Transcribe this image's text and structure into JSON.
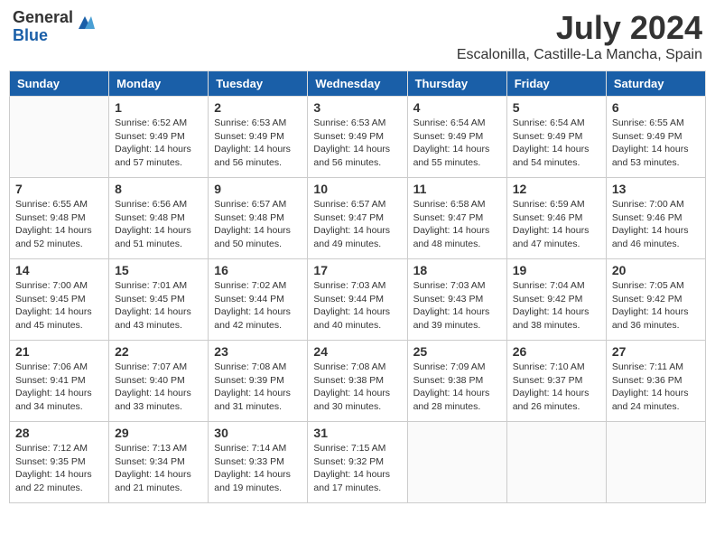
{
  "logo": {
    "general": "General",
    "blue": "Blue"
  },
  "title": "July 2024",
  "subtitle": "Escalonilla, Castille-La Mancha, Spain",
  "headers": [
    "Sunday",
    "Monday",
    "Tuesday",
    "Wednesday",
    "Thursday",
    "Friday",
    "Saturday"
  ],
  "weeks": [
    [
      {
        "day": "",
        "empty": true
      },
      {
        "day": "1",
        "rise": "6:52 AM",
        "set": "9:49 PM",
        "daylight": "14 hours and 57 minutes."
      },
      {
        "day": "2",
        "rise": "6:53 AM",
        "set": "9:49 PM",
        "daylight": "14 hours and 56 minutes."
      },
      {
        "day": "3",
        "rise": "6:53 AM",
        "set": "9:49 PM",
        "daylight": "14 hours and 56 minutes."
      },
      {
        "day": "4",
        "rise": "6:54 AM",
        "set": "9:49 PM",
        "daylight": "14 hours and 55 minutes."
      },
      {
        "day": "5",
        "rise": "6:54 AM",
        "set": "9:49 PM",
        "daylight": "14 hours and 54 minutes."
      },
      {
        "day": "6",
        "rise": "6:55 AM",
        "set": "9:49 PM",
        "daylight": "14 hours and 53 minutes."
      }
    ],
    [
      {
        "day": "7",
        "rise": "6:55 AM",
        "set": "9:48 PM",
        "daylight": "14 hours and 52 minutes."
      },
      {
        "day": "8",
        "rise": "6:56 AM",
        "set": "9:48 PM",
        "daylight": "14 hours and 51 minutes."
      },
      {
        "day": "9",
        "rise": "6:57 AM",
        "set": "9:48 PM",
        "daylight": "14 hours and 50 minutes."
      },
      {
        "day": "10",
        "rise": "6:57 AM",
        "set": "9:47 PM",
        "daylight": "14 hours and 49 minutes."
      },
      {
        "day": "11",
        "rise": "6:58 AM",
        "set": "9:47 PM",
        "daylight": "14 hours and 48 minutes."
      },
      {
        "day": "12",
        "rise": "6:59 AM",
        "set": "9:46 PM",
        "daylight": "14 hours and 47 minutes."
      },
      {
        "day": "13",
        "rise": "7:00 AM",
        "set": "9:46 PM",
        "daylight": "14 hours and 46 minutes."
      }
    ],
    [
      {
        "day": "14",
        "rise": "7:00 AM",
        "set": "9:45 PM",
        "daylight": "14 hours and 45 minutes."
      },
      {
        "day": "15",
        "rise": "7:01 AM",
        "set": "9:45 PM",
        "daylight": "14 hours and 43 minutes."
      },
      {
        "day": "16",
        "rise": "7:02 AM",
        "set": "9:44 PM",
        "daylight": "14 hours and 42 minutes."
      },
      {
        "day": "17",
        "rise": "7:03 AM",
        "set": "9:44 PM",
        "daylight": "14 hours and 40 minutes."
      },
      {
        "day": "18",
        "rise": "7:03 AM",
        "set": "9:43 PM",
        "daylight": "14 hours and 39 minutes."
      },
      {
        "day": "19",
        "rise": "7:04 AM",
        "set": "9:42 PM",
        "daylight": "14 hours and 38 minutes."
      },
      {
        "day": "20",
        "rise": "7:05 AM",
        "set": "9:42 PM",
        "daylight": "14 hours and 36 minutes."
      }
    ],
    [
      {
        "day": "21",
        "rise": "7:06 AM",
        "set": "9:41 PM",
        "daylight": "14 hours and 34 minutes."
      },
      {
        "day": "22",
        "rise": "7:07 AM",
        "set": "9:40 PM",
        "daylight": "14 hours and 33 minutes."
      },
      {
        "day": "23",
        "rise": "7:08 AM",
        "set": "9:39 PM",
        "daylight": "14 hours and 31 minutes."
      },
      {
        "day": "24",
        "rise": "7:08 AM",
        "set": "9:38 PM",
        "daylight": "14 hours and 30 minutes."
      },
      {
        "day": "25",
        "rise": "7:09 AM",
        "set": "9:38 PM",
        "daylight": "14 hours and 28 minutes."
      },
      {
        "day": "26",
        "rise": "7:10 AM",
        "set": "9:37 PM",
        "daylight": "14 hours and 26 minutes."
      },
      {
        "day": "27",
        "rise": "7:11 AM",
        "set": "9:36 PM",
        "daylight": "14 hours and 24 minutes."
      }
    ],
    [
      {
        "day": "28",
        "rise": "7:12 AM",
        "set": "9:35 PM",
        "daylight": "14 hours and 22 minutes."
      },
      {
        "day": "29",
        "rise": "7:13 AM",
        "set": "9:34 PM",
        "daylight": "14 hours and 21 minutes."
      },
      {
        "day": "30",
        "rise": "7:14 AM",
        "set": "9:33 PM",
        "daylight": "14 hours and 19 minutes."
      },
      {
        "day": "31",
        "rise": "7:15 AM",
        "set": "9:32 PM",
        "daylight": "14 hours and 17 minutes."
      },
      {
        "day": "",
        "empty": true
      },
      {
        "day": "",
        "empty": true
      },
      {
        "day": "",
        "empty": true
      }
    ]
  ]
}
